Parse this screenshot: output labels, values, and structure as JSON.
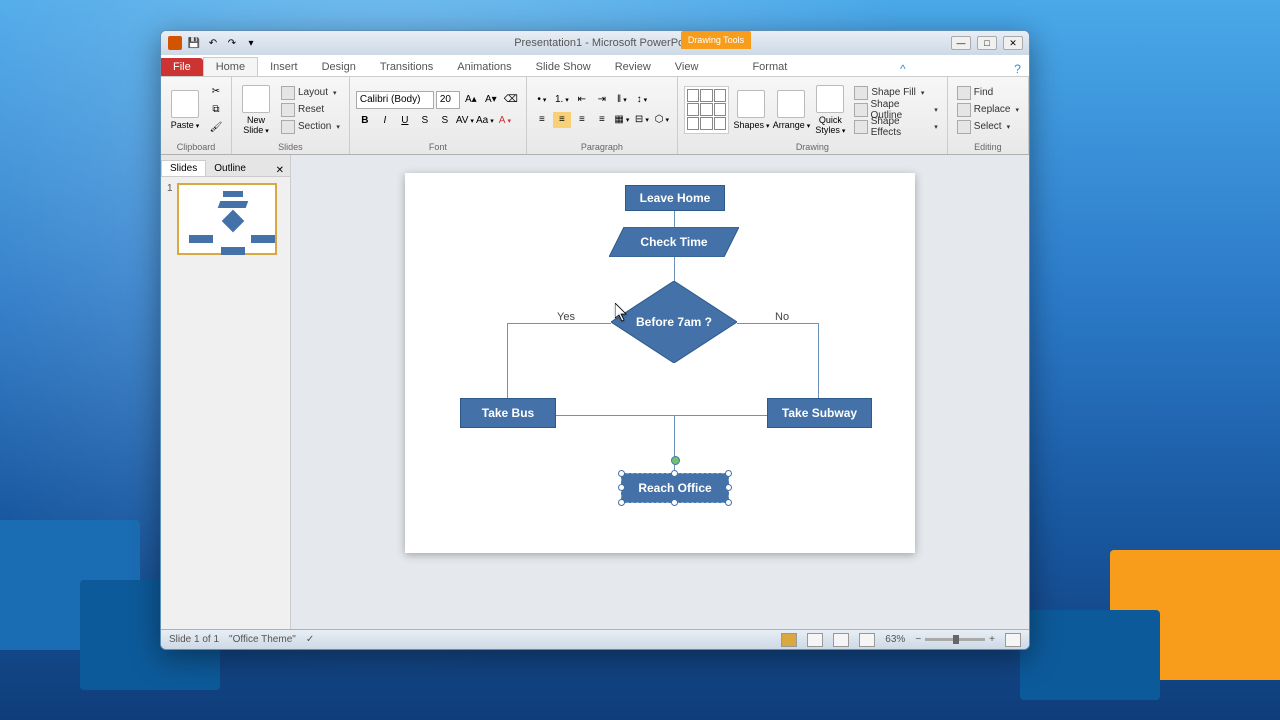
{
  "window": {
    "title": "Presentation1 - Microsoft PowerPoint",
    "contextTab": "Drawing Tools"
  },
  "tabs": {
    "file": "File",
    "home": "Home",
    "insert": "Insert",
    "design": "Design",
    "transitions": "Transitions",
    "animations": "Animations",
    "slideshow": "Slide Show",
    "review": "Review",
    "view": "View",
    "format": "Format"
  },
  "ribbon": {
    "clipboard": {
      "label": "Clipboard",
      "paste": "Paste"
    },
    "slides": {
      "label": "Slides",
      "newSlide": "New Slide",
      "layout": "Layout",
      "reset": "Reset",
      "section": "Section"
    },
    "font": {
      "label": "Font",
      "name": "Calibri (Body)",
      "size": "20"
    },
    "paragraph": {
      "label": "Paragraph"
    },
    "drawing": {
      "label": "Drawing",
      "shapes": "Shapes",
      "arrange": "Arrange",
      "quickStyles": "Quick Styles",
      "shapeFill": "Shape Fill",
      "shapeOutline": "Shape Outline",
      "shapeEffects": "Shape Effects"
    },
    "editing": {
      "label": "Editing",
      "find": "Find",
      "replace": "Replace",
      "select": "Select"
    }
  },
  "panel": {
    "slides": "Slides",
    "outline": "Outline",
    "thumbNum": "1"
  },
  "flowchart": {
    "leaveHome": "Leave Home",
    "checkTime": "Check Time",
    "decision": "Before 7am ?",
    "yes": "Yes",
    "no": "No",
    "takeBus": "Take Bus",
    "takeSubway": "Take Subway",
    "reachOffice": "Reach Office"
  },
  "status": {
    "slide": "Slide 1 of 1",
    "theme": "\"Office Theme\"",
    "zoom": "63%"
  }
}
